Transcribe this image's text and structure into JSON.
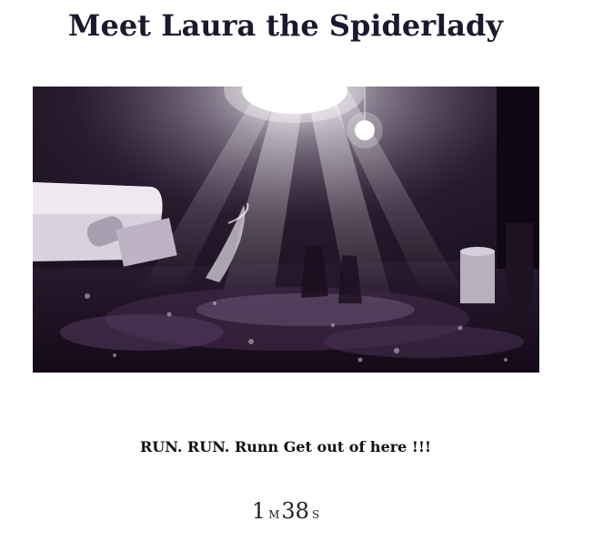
{
  "page": {
    "title": "Meet Laura the Spiderlady"
  },
  "image": {
    "description_icon": "dark-flooded-room-scene-image"
  },
  "message": {
    "text": "RUN. RUN. Runn Get out of here !!!"
  },
  "countdown": {
    "minutes": "1",
    "minutes_unit": "m",
    "seconds": "38",
    "seconds_unit": "s"
  },
  "colors": {
    "title": "#1a1a2e",
    "text": "#111111",
    "scene_dark": "#0d0812",
    "scene_purple": "#3a2440",
    "light": "#f4f0f6"
  }
}
